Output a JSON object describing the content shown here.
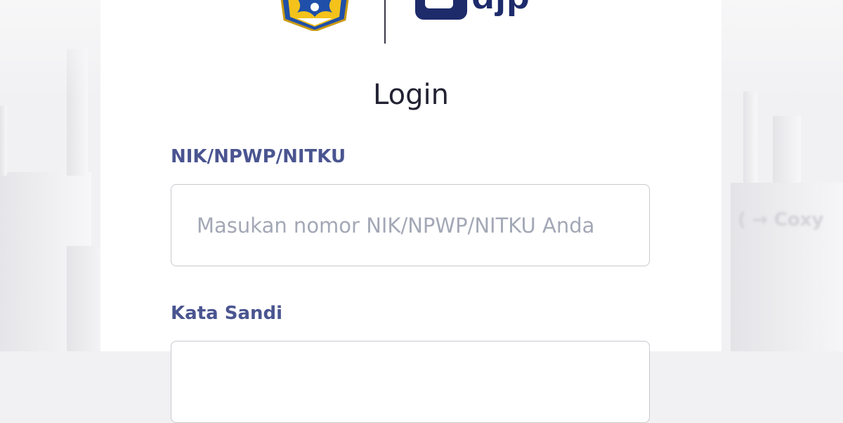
{
  "header": {
    "emblem_icon": "kemenkeu-emblem-icon",
    "brand_logo_text": "djp"
  },
  "login": {
    "title": "Login",
    "username_label": "NIK/NPWP/NITKU",
    "username_placeholder": "Masukan nomor NIK/NPWP/NITKU Anda",
    "username_value": "",
    "password_label": "Kata Sandi",
    "password_value": ""
  },
  "background": {
    "decor_text_right": "( → Coxy"
  },
  "colors": {
    "label": "#4a5590",
    "brand": "#1d2b6b",
    "accent": "#f2b51c",
    "emblem_blue": "#1f4fa8",
    "emblem_gold": "#f4c21a"
  }
}
